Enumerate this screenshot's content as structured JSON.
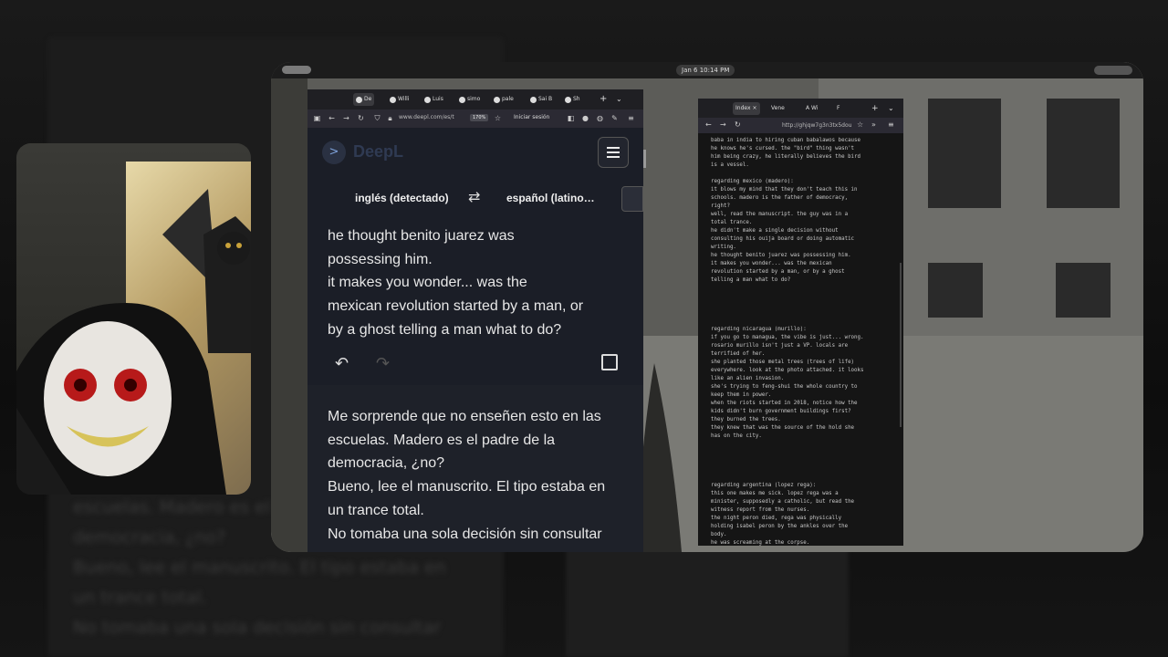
{
  "desktop": {
    "clock": "Jan 6  10:14 PM"
  },
  "deepl_browser": {
    "tabs": [
      "De",
      "Willi",
      "Luis",
      "simo",
      "pale",
      "Sai B",
      "Sh"
    ],
    "url": "www.deepl.com/es/t",
    "zoom": "170%",
    "login": "Iniciar sesión",
    "logo_text": "DeepL",
    "source_lang": "inglés (detectado)",
    "target_lang": "español (latino…",
    "source_text": "he thought benito juarez was\npossessing him.\nit makes you wonder... was the\nmexican revolution started by a man, or\nby a ghost telling a man what to do?",
    "target_text": "Me sorprende que no enseñen esto en las\nescuelas. Madero es el padre de la\ndemocracia, ¿no?\nBueno, lee el manuscrito. El tipo estaba en\nun trance total.\nNo tomaba una sola decisión sin consultar"
  },
  "notes_browser": {
    "tabs": [
      "Index",
      "Vene",
      "A Wi",
      "F"
    ],
    "url": "http://ghjqw7g3n3tx5dou",
    "content": "baba in india to hiring cuban babalawos because\nhe knows he's cursed. the \"bird\" thing wasn't\nhim being crazy, he literally believes the bird\nis a vessel.\n\nregarding mexico (madero):\nit blows my mind that they don't teach this in\nschools. madero is the father of democracy,\nright?\nwell, read the manuscript. the guy was in a\ntotal trance.\nhe didn't make a single decision without\nconsulting his ouija board or doing automatic\nwriting.\nhe thought benito juarez was possessing him.\nit makes you wonder... was the mexican\nrevolution started by a man, or by a ghost\ntelling a man what to do?\n\n\n\n\n\nregarding nicaragua (murillo):\nif you go to managua, the vibe is just... wrong.\nrosario murillo isn't just a VP. locals are\nterrified of her.\nshe planted those metal trees (trees of life)\neverywhere. look at the photo attached. it looks\nlike an alien invasion.\nshe's trying to feng-shui the whole country to\nkeep them in power.\nwhen the riots started in 2018, notice how the\nkids didn't burn government buildings first?\nthey burned the trees.\nthey knew that was the source of the hold she\nhas on the city.\n\n\n\n\n\nregarding argentina (lopez rega):\nthis one makes me sick. lopez rega was a\nminister, supposedly a catholic, but read the\nwitness report from the nurses.\nthe night peron died, rega was physically\nholding isabel peron by the ankles over the\nbody.\nhe was screaming at the corpse.\nhe thought he could physically suck the charisma"
  },
  "background": {
    "ghost_text": "escuelas. Madero es el padre de la\ndemocracia, ¿no?\nBueno, lee el manuscrito. El tipo estaba en\nun trance total.\nNo tomaba una sola decisión sin consultar"
  }
}
